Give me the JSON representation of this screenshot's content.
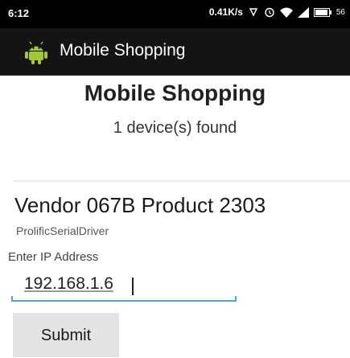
{
  "status_bar": {
    "time": "6:12",
    "network_speed": "0.41K/s",
    "battery_text": "56",
    "icons": [
      "sync-icon",
      "alarm-icon",
      "wifi-icon",
      "signal-icon",
      "battery-icon"
    ]
  },
  "action_bar": {
    "title": "Mobile Shopping",
    "icon": "android-icon",
    "background": "#141414"
  },
  "content": {
    "title": "Mobile Shopping",
    "device_count_text": "1 device(s) found"
  },
  "device": {
    "name": "Vendor 067B Product 2303",
    "driver": "ProlificSerialDriver"
  },
  "ip_form": {
    "label": "Enter IP Address",
    "value": "192.168.1.6",
    "accent_color": "#4fa9d4"
  },
  "submit": {
    "label": "Submit"
  }
}
